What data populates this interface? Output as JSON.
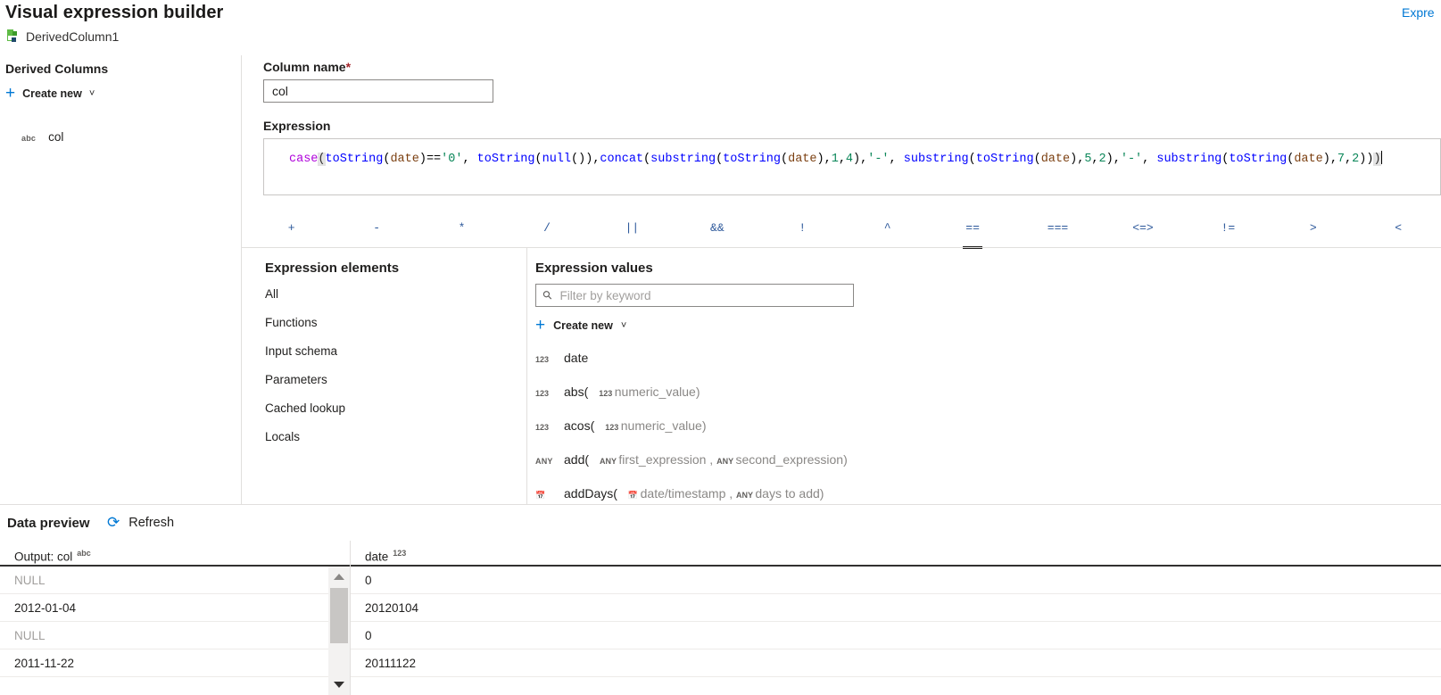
{
  "header": {
    "title": "Visual expression builder",
    "breadcrumb_label": "DerivedColumn1",
    "breadcrumb_icon": "derived-column-icon",
    "top_right_link": "Expre"
  },
  "left_panel": {
    "title": "Derived Columns",
    "create_new_label": "Create new",
    "create_new_icon": "plus-icon",
    "chevron_icon": "chevron-down-icon",
    "items": [
      {
        "type": "abc",
        "name": "col"
      }
    ]
  },
  "form": {
    "column_name_label": "Column name",
    "required_marker": "*",
    "column_name_value": "col",
    "expression_label": "Expression",
    "expression_text": "case(toString(date)=='0', toString(null()),concat(substring(toString(date),1,4),'-', substring(toString(date),5,2),'-', substring(toString(date),7,2)))",
    "expression_tokens": [
      {
        "t": "case",
        "c": "kw"
      },
      {
        "t": "(",
        "c": "bracket-hl"
      },
      {
        "t": "toString",
        "c": "fn"
      },
      {
        "t": "(",
        "c": "punc"
      },
      {
        "t": "date",
        "c": "var"
      },
      {
        "t": ")",
        "c": "punc"
      },
      {
        "t": "==",
        "c": "op"
      },
      {
        "t": "'0'",
        "c": "str"
      },
      {
        "t": ", ",
        "c": "punc"
      },
      {
        "t": "toString",
        "c": "fn"
      },
      {
        "t": "(",
        "c": "punc"
      },
      {
        "t": "null",
        "c": "fn"
      },
      {
        "t": "())",
        "c": "punc"
      },
      {
        "t": ",",
        "c": "punc"
      },
      {
        "t": "concat",
        "c": "fn"
      },
      {
        "t": "(",
        "c": "punc"
      },
      {
        "t": "substring",
        "c": "fn"
      },
      {
        "t": "(",
        "c": "punc"
      },
      {
        "t": "toString",
        "c": "fn"
      },
      {
        "t": "(",
        "c": "punc"
      },
      {
        "t": "date",
        "c": "var"
      },
      {
        "t": "),",
        "c": "punc"
      },
      {
        "t": "1",
        "c": "num"
      },
      {
        "t": ",",
        "c": "punc"
      },
      {
        "t": "4",
        "c": "num"
      },
      {
        "t": "),",
        "c": "punc"
      },
      {
        "t": "'-'",
        "c": "str"
      },
      {
        "t": ", ",
        "c": "punc"
      },
      {
        "t": "substring",
        "c": "fn"
      },
      {
        "t": "(",
        "c": "punc"
      },
      {
        "t": "toString",
        "c": "fn"
      },
      {
        "t": "(",
        "c": "punc"
      },
      {
        "t": "date",
        "c": "var"
      },
      {
        "t": "),",
        "c": "punc"
      },
      {
        "t": "5",
        "c": "num"
      },
      {
        "t": ",",
        "c": "punc"
      },
      {
        "t": "2",
        "c": "num"
      },
      {
        "t": "),",
        "c": "punc"
      },
      {
        "t": "'-'",
        "c": "str"
      },
      {
        "t": ", ",
        "c": "punc"
      },
      {
        "t": "substring",
        "c": "fn"
      },
      {
        "t": "(",
        "c": "punc"
      },
      {
        "t": "toString",
        "c": "fn"
      },
      {
        "t": "(",
        "c": "punc"
      },
      {
        "t": "date",
        "c": "var"
      },
      {
        "t": "),",
        "c": "punc"
      },
      {
        "t": "7",
        "c": "num"
      },
      {
        "t": ",",
        "c": "punc"
      },
      {
        "t": "2",
        "c": "num"
      },
      {
        "t": "))",
        "c": "punc"
      },
      {
        "t": ")",
        "c": "bracket-hl"
      }
    ]
  },
  "operators": [
    {
      "label": "+",
      "selected": false
    },
    {
      "label": "-",
      "selected": false
    },
    {
      "label": "*",
      "selected": false
    },
    {
      "label": "/",
      "selected": false
    },
    {
      "label": "||",
      "selected": false
    },
    {
      "label": "&&",
      "selected": false
    },
    {
      "label": "!",
      "selected": false
    },
    {
      "label": "^",
      "selected": false
    },
    {
      "label": "==",
      "selected": true
    },
    {
      "label": "===",
      "selected": false
    },
    {
      "label": "<=>",
      "selected": false
    },
    {
      "label": "!=",
      "selected": false
    },
    {
      "label": ">",
      "selected": false
    },
    {
      "label": "<",
      "selected": false
    }
  ],
  "expression_elements": {
    "title": "Expression elements",
    "items": [
      {
        "label": "All"
      },
      {
        "label": "Functions"
      },
      {
        "label": "Input schema"
      },
      {
        "label": "Parameters"
      },
      {
        "label": "Cached lookup"
      },
      {
        "label": "Locals"
      }
    ]
  },
  "expression_values": {
    "title": "Expression values",
    "filter_placeholder": "Filter by keyword",
    "filter_value": "",
    "search_icon": "search-icon",
    "create_new_label": "Create new",
    "items": [
      {
        "type": "123",
        "name": "date",
        "signature": ""
      },
      {
        "type": "123",
        "name": "abs(",
        "signature": "numeric_value)",
        "ptype": "123"
      },
      {
        "type": "123",
        "name": "acos(",
        "signature": "numeric_value)",
        "ptype": "123"
      },
      {
        "type": "ANY",
        "name": "add(",
        "signature": "first_expression , ",
        "ptype": "ANY",
        "ptype2": "ANY",
        "signature2": "second_expression)"
      },
      {
        "type": "cal",
        "name": "addDays(",
        "signature": "date/timestamp , ",
        "ptype": "cal",
        "ptype2": "ANY",
        "signature2": "days to add)"
      }
    ]
  },
  "data_preview": {
    "title": "Data preview",
    "refresh_label": "Refresh",
    "refresh_icon": "refresh-icon",
    "columns": [
      {
        "label": "Output: col",
        "type": "abc"
      },
      {
        "label": "date",
        "type": "123"
      }
    ],
    "rows": [
      {
        "col": "NULL",
        "date": "0",
        "is_null": true
      },
      {
        "col": "2012-01-04",
        "date": "20120104",
        "is_null": false
      },
      {
        "col": "NULL",
        "date": "0",
        "is_null": true
      },
      {
        "col": "2011-11-22",
        "date": "20111122",
        "is_null": false
      }
    ],
    "scrollbar": {
      "up_icon": "arrow-up-icon",
      "down_icon": "arrow-down-icon"
    }
  },
  "colors": {
    "accent": "#0078d4",
    "required": "#a4262c",
    "border": "#e1dfdd",
    "token_keyword": "#af00db",
    "token_function": "#0000ff",
    "token_variable": "#7b3f10",
    "token_string": "#098658"
  }
}
